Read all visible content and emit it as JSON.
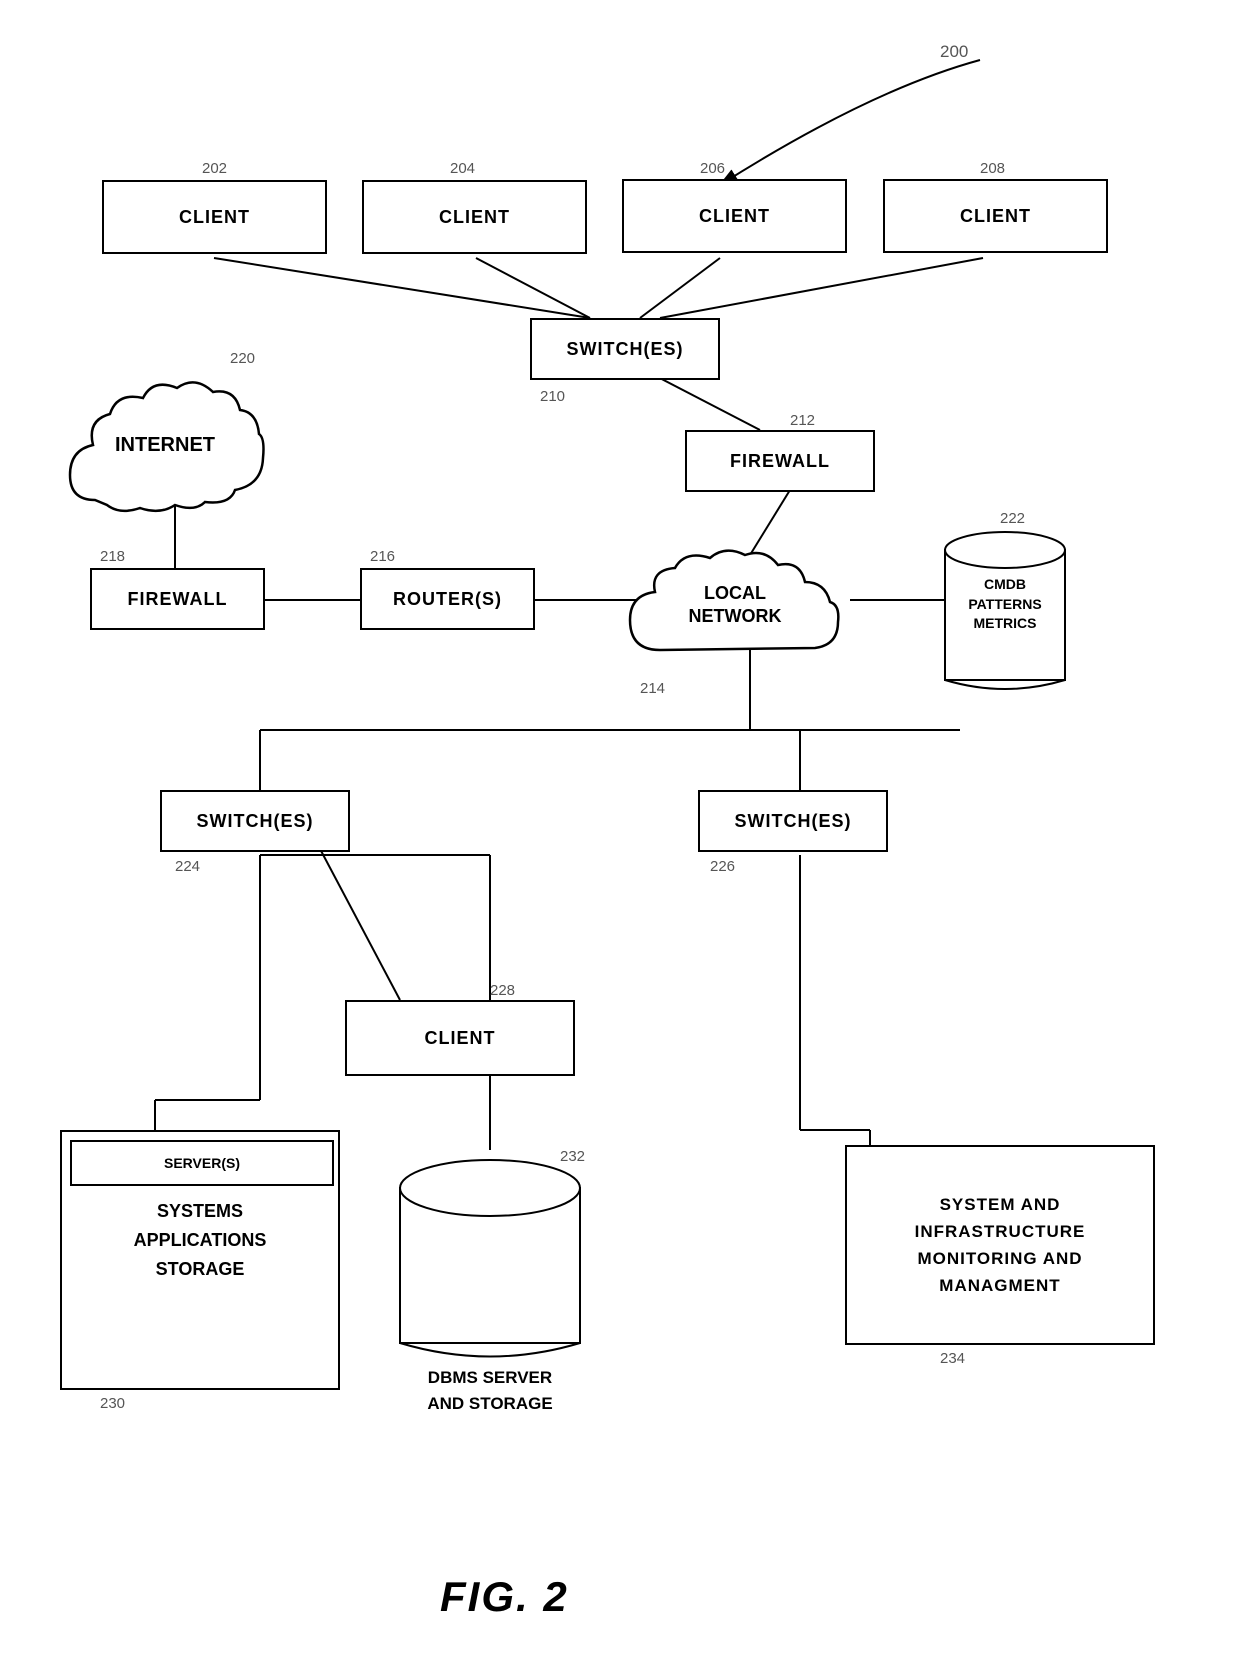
{
  "diagram": {
    "title": "FIG. 2",
    "nodes": {
      "client1": {
        "label": "CLIENT",
        "id": "202"
      },
      "client2": {
        "label": "CLIENT",
        "id": "204"
      },
      "client3": {
        "label": "CLIENT",
        "id": "206"
      },
      "client4": {
        "label": "CLIENT",
        "id": "208"
      },
      "switches_top": {
        "label": "SWITCH(ES)",
        "id": "210"
      },
      "firewall_top": {
        "label": "FIREWALL",
        "id": "212"
      },
      "local_network": {
        "label": "LOCAL\nNETWORK",
        "id": "214"
      },
      "router": {
        "label": "ROUTER(S)",
        "id": "216"
      },
      "firewall_left": {
        "label": "FIREWALL",
        "id": "218"
      },
      "internet": {
        "label": "INTERNET",
        "id": "220"
      },
      "cmdb": {
        "label": "CMDB\nPATTERNS\nMETRICS",
        "id": "222"
      },
      "switches_left": {
        "label": "SWITCH(ES)",
        "id": "224"
      },
      "switches_right": {
        "label": "SWITCH(ES)",
        "id": "226"
      },
      "client_bottom": {
        "label": "CLIENT",
        "id": "228"
      },
      "servers": {
        "label": "SERVER(S)\n\nSYSTEMS\nAPPLICATIONS\nSTORAGE",
        "id": "230"
      },
      "dbms": {
        "label": "DBMS SERVER\nAND STORAGE",
        "id": "232"
      },
      "sysinfra": {
        "label": "SYSTEM AND\nINFRASTRUCTURE\nMONITORING AND\nMANAGMENT",
        "id": "234"
      },
      "ref_200": {
        "id": "200"
      }
    }
  }
}
